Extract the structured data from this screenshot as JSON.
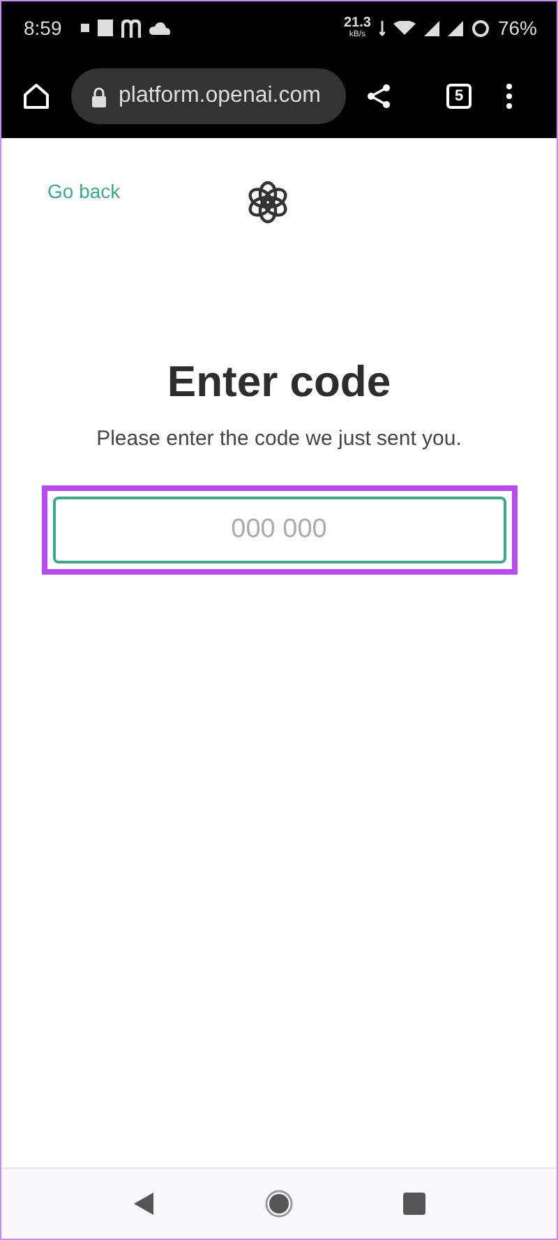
{
  "status_bar": {
    "time": "8:59",
    "speed_value": "21.3",
    "speed_unit": "kB/s",
    "battery": "76%"
  },
  "browser": {
    "url": "platform.openai.com",
    "tab_count": "5"
  },
  "page": {
    "back_link": "Go back",
    "title": "Enter code",
    "subtitle": "Please enter the code we just sent you.",
    "code_field": {
      "placeholder": "000 000",
      "highlighted": true
    }
  }
}
